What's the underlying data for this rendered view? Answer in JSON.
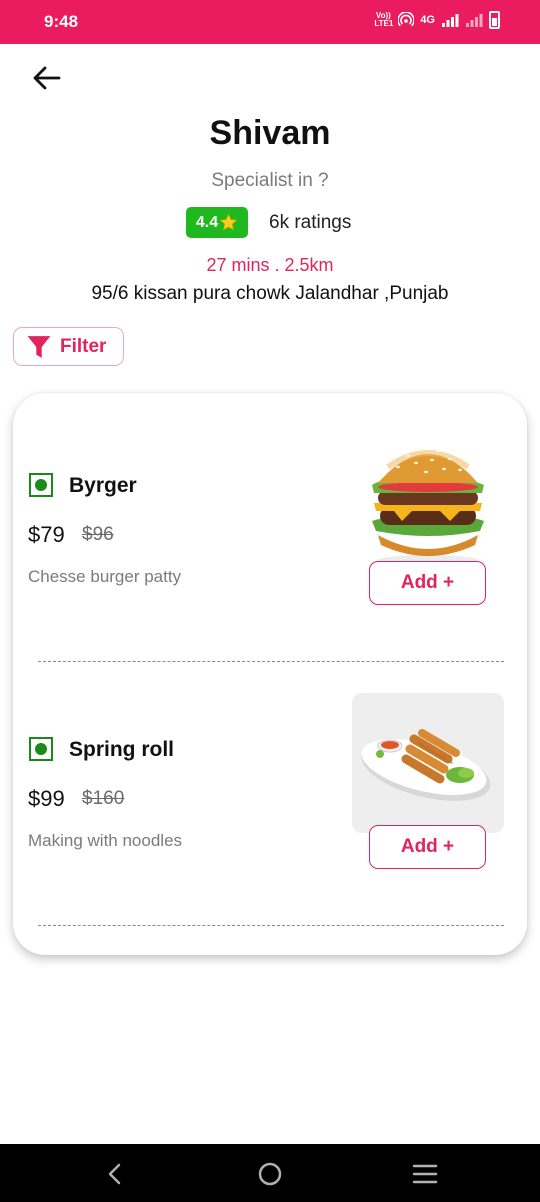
{
  "status_bar": {
    "time": "9:48",
    "volte_top": "Vo))",
    "volte_bottom": "LTE1",
    "network": "4G"
  },
  "shop": {
    "name": "Shivam",
    "specialist": "Specialist in ?",
    "rating": "4.4",
    "rating_count": "6k ratings",
    "eta": "27 mins . 2.5km",
    "address": "95/6 kissan pura chowk Jalandhar ,Punjab"
  },
  "filter": {
    "label": "Filter"
  },
  "menu": {
    "items": [
      {
        "name": "Byrger",
        "price": "$79",
        "old_price": "$96",
        "description": "Chesse burger patty",
        "add_label": "Add +",
        "veg": true
      },
      {
        "name": "Spring roll",
        "price": "$99",
        "old_price": "$160",
        "description": "Making with noodles",
        "add_label": "Add +",
        "veg": true
      }
    ]
  },
  "colors": {
    "accent": "#e0245e",
    "status_bar": "#ea1b5f",
    "rating_badge": "#1fb81f",
    "veg": "#1a8a1a"
  },
  "icons": {
    "back": "arrow-left-icon",
    "filter": "funnel-icon",
    "star": "star-icon",
    "nav_back": "chevron-left-icon",
    "nav_home": "circle-home-icon",
    "nav_menu": "hamburger-menu-icon"
  }
}
